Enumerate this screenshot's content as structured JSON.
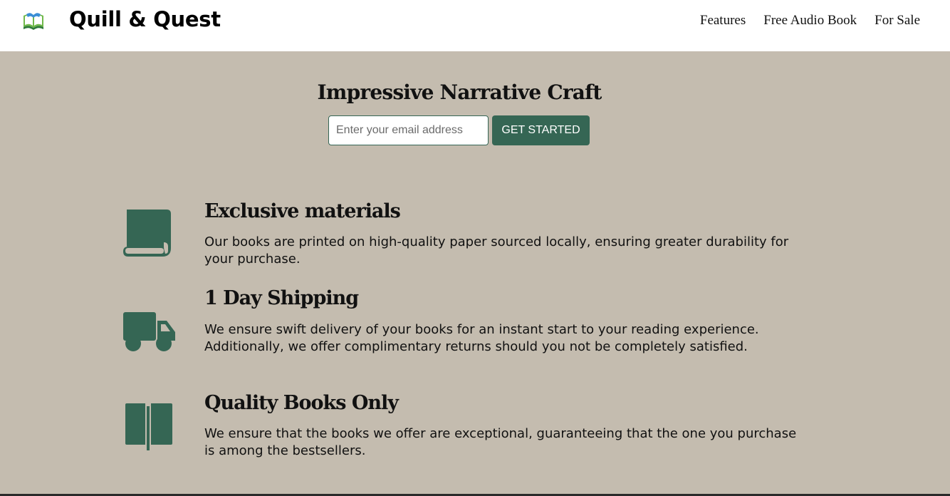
{
  "header": {
    "brand": "Quill & Quest",
    "logo_icon": "open-book-icon",
    "nav": [
      "Features",
      "Free Audio Book",
      "For Sale"
    ]
  },
  "hero": {
    "title": "Impressive Narrative Craft",
    "email_placeholder": "Enter your email address",
    "cta_label": "GET STARTED"
  },
  "features": [
    {
      "icon": "scroll-book-icon",
      "title": "Exclusive materials",
      "text": "Our books are printed on high-quality paper sourced locally, ensuring greater durability for your purchase."
    },
    {
      "icon": "truck-icon",
      "title": "1 Day Shipping",
      "text": "We ensure swift delivery of your books for an instant start to your reading experience. Additionally, we offer complimentary returns should you not be completely satisfied."
    },
    {
      "icon": "open-book-icon",
      "title": "Quality Books Only",
      "text": "We ensure that the books we offer are exceptional, guaranteeing that the one you purchase is among the bestsellers."
    }
  ],
  "colors": {
    "background": "#c4bcaf",
    "accent": "#356654",
    "header": "#ffffff"
  }
}
